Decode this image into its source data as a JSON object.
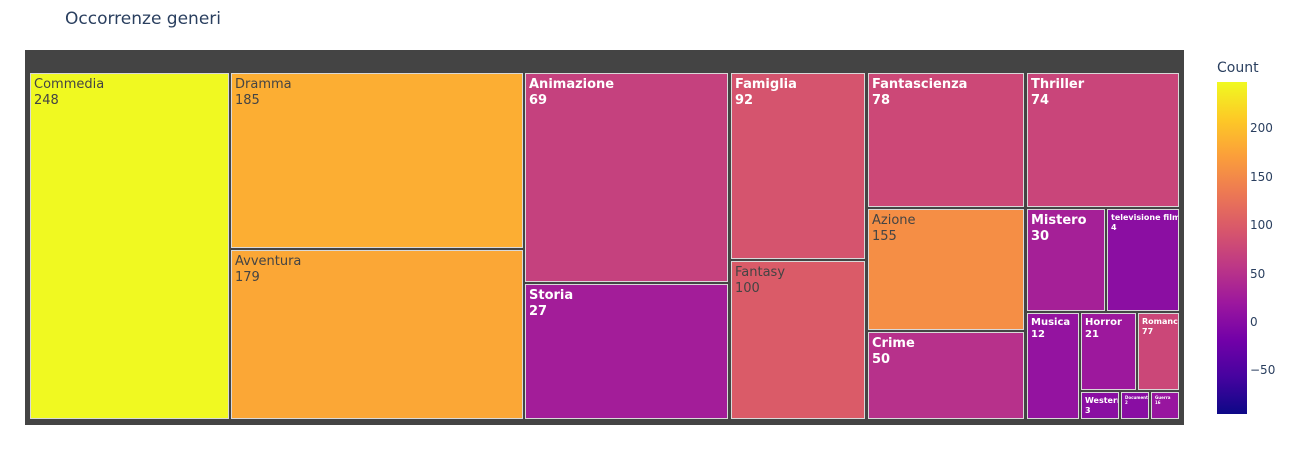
{
  "chart_data": {
    "type": "treemap",
    "title": "Occorrenze generi",
    "colorbar": {
      "title": "Count",
      "range": [
        -95,
        248
      ],
      "ticks": [
        200,
        150,
        100,
        50,
        0,
        -50
      ],
      "tick_labels": [
        "200",
        "150",
        "100",
        "50",
        "0",
        "−50"
      ],
      "colorscale": [
        "#0d0887",
        "#46039f",
        "#7201a8",
        "#9c179e",
        "#bd3786",
        "#d8576b",
        "#ed7953",
        "#fb9f3a",
        "#fdca26",
        "#f0f921"
      ]
    },
    "tiles": [
      {
        "label": "Commedia",
        "value": 248
      },
      {
        "label": "Dramma",
        "value": 185
      },
      {
        "label": "Avventura",
        "value": 179
      },
      {
        "label": "Animazione",
        "value": 69
      },
      {
        "label": "Storia",
        "value": 27
      },
      {
        "label": "Famiglia",
        "value": 92
      },
      {
        "label": "Fantasy",
        "value": 100
      },
      {
        "label": "Fantascienza",
        "value": 78
      },
      {
        "label": "Azione",
        "value": 155
      },
      {
        "label": "Crime",
        "value": 50
      },
      {
        "label": "Thriller",
        "value": 74
      },
      {
        "label": "Mistero",
        "value": 30
      },
      {
        "label": "televisione film",
        "value": 4
      },
      {
        "label": "Musica",
        "value": 12
      },
      {
        "label": "Horror",
        "value": 21
      },
      {
        "label": "Romance",
        "value": 77
      },
      {
        "label": "Western",
        "value": 3
      },
      {
        "label": "Documentario",
        "value": 2
      },
      {
        "label": "Guerra",
        "value": 16
      }
    ]
  }
}
